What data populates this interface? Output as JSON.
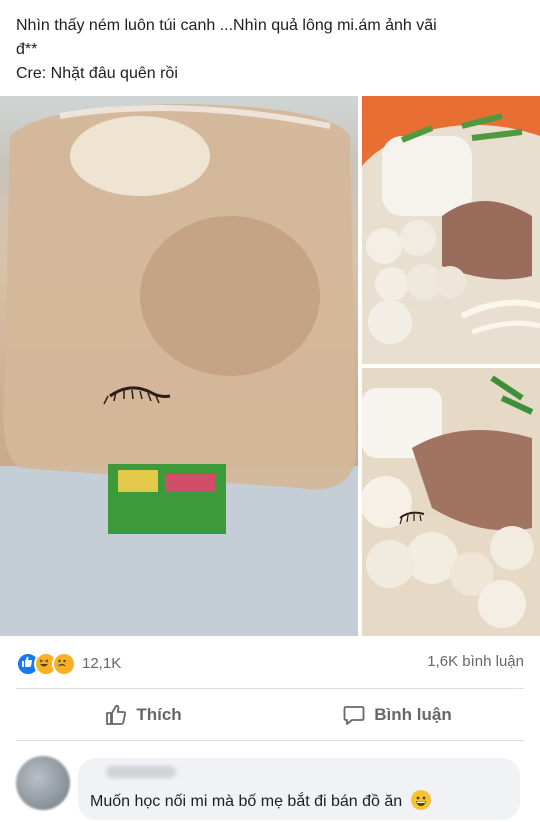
{
  "post": {
    "line1": "Nhìn thấy ném luôn túi canh ...Nhìn quả lông mi.ám ảnh vãi\nđ**",
    "line2": "Cre: Nhặt đâu quên rồi"
  },
  "photos": [
    {
      "name": "photo-soup-bag",
      "subject": "bag of soup with an eyelash"
    },
    {
      "name": "photo-soup-bowl-top",
      "subject": "bowl of soup with fish balls and pork"
    },
    {
      "name": "photo-soup-bowl-bottom",
      "subject": "close-up of fish balls and pork with eyelash"
    }
  ],
  "stats": {
    "reaction_icons": [
      "like-reaction-icon",
      "haha-reaction-icon",
      "sad-reaction-icon"
    ],
    "reaction_count": "12,1K",
    "comment_count": "1,6K bình luận"
  },
  "actions": {
    "like_label": "Thích",
    "comment_label": "Bình luận"
  },
  "comment": {
    "author": "",
    "text": "Muốn học nối mi mà bố mẹ bắt đi bán đồ ăn",
    "emoji": "grinning-emoji-icon"
  },
  "colors": {
    "like_blue": "#1877f2",
    "reaction_yellow": "#f7b125",
    "muted_text": "#65676b",
    "bubble_bg": "#f0f2f5"
  }
}
